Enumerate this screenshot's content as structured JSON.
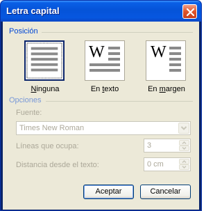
{
  "window": {
    "title": "Letra capital"
  },
  "posicion": {
    "group_label": "Posición",
    "options": [
      {
        "label_ul": "N",
        "label_rest": "inguna",
        "selected": true
      },
      {
        "label_pre": "En ",
        "label_ul": "t",
        "label_rest": "exto",
        "glyph": "W"
      },
      {
        "label_pre": "En ",
        "label_ul": "m",
        "label_rest": "argen",
        "glyph": "W"
      }
    ]
  },
  "opciones": {
    "group_label": "Opciones",
    "fuente_label": "Fuente:",
    "fuente_value": "Times New Roman",
    "lineas_label": "Líneas que ocupa:",
    "lineas_value": "3",
    "distancia_label": "Distancia desde el texto:",
    "distancia_value": "0 cm"
  },
  "buttons": {
    "ok": "Aceptar",
    "cancel": "Cancelar"
  },
  "colors": {
    "title_bar": "#0553d8",
    "group_title": "#0046d5",
    "dialog_bg": "#ece9d8"
  }
}
